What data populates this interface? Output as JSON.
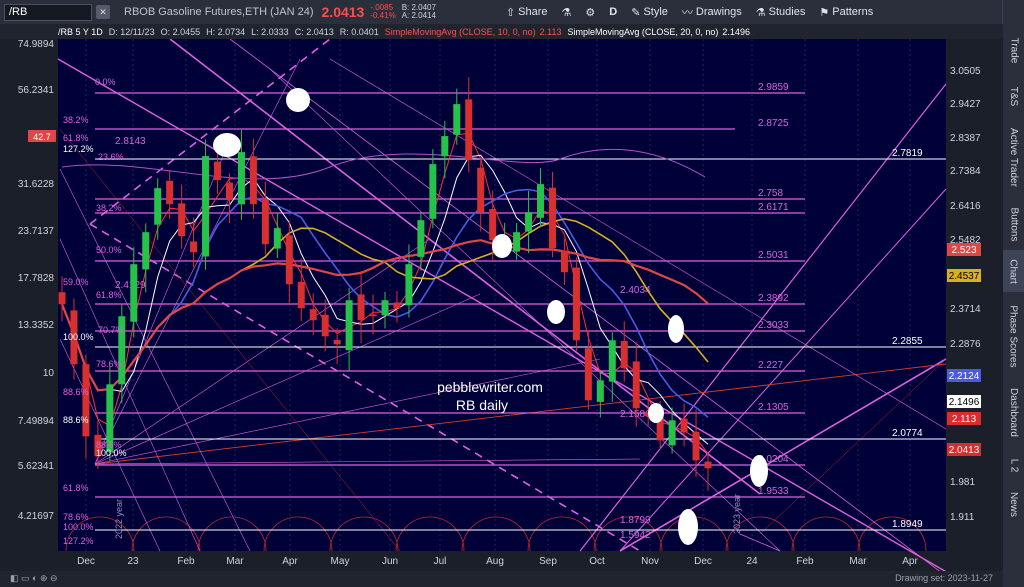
{
  "toolbar": {
    "symbol": "/RB",
    "description": "RBOB Gasoline Futures,ETH (JAN 24)",
    "last_price": "2.0413",
    "change": "-.0085",
    "change_pct": "-0.41%",
    "bid": "B: 2.0407",
    "ask": "A: 2.0414",
    "share": "Share",
    "interval": "D",
    "style": "Style",
    "drawings": "Drawings",
    "studies": "Studies",
    "patterns": "Patterns"
  },
  "sidebar": {
    "tabs": [
      "Trade",
      "T&S",
      "Active Trader",
      "Buttons",
      "Chart",
      "Phase Scores",
      "Dashboard",
      "L 2",
      "News"
    ],
    "active": "Chart"
  },
  "study_bar": {
    "label": "/RB 5 Y 1D",
    "date": "D: 12/11/23",
    "open": "O: 2.0455",
    "high": "H: 2.0734",
    "low": "L: 2.0333",
    "close": "C: 2.0413",
    "range": "R: 0.0401",
    "sma10": "SimpleMovingAvg (CLOSE, 10, 0, no)",
    "sma10_val": "2.113",
    "sma20": "SimpleMovingAvg (CLOSE, 20, 0, no)",
    "sma20_val": "2.1496"
  },
  "bottom": {
    "drawing_set": "Drawing set: 2023-11-27"
  },
  "chart_data": {
    "type": "line",
    "title": "RB daily",
    "watermark": "pebblewriter.com",
    "x_ticks": [
      "Dec",
      "23",
      "Feb",
      "Mar",
      "Apr",
      "May",
      "Jun",
      "Jul",
      "Aug",
      "Sep",
      "Oct",
      "Nov",
      "Dec",
      "24",
      "Feb",
      "Mar",
      "Apr"
    ],
    "x_tick_pos": [
      86,
      133,
      186,
      235,
      290,
      340,
      390,
      440,
      495,
      548,
      597,
      650,
      703,
      752,
      805,
      858,
      910
    ],
    "right_axis": [
      "3.0505",
      "2.9427",
      "2.8387",
      "2.7384",
      "2.6416",
      "2.5482",
      "2.4583",
      "2.3714",
      "2.2876",
      "2.2068",
      "2.1496",
      "2.113",
      "2.0413",
      "1.981",
      "1.911"
    ],
    "left_axis": [
      "74.9894",
      "56.2341",
      "42",
      "31.6228",
      "23.7137",
      "17.7828",
      "13.3352",
      "10",
      "7.49894",
      "5.62341",
      "4.21697"
    ],
    "price_tags": [
      {
        "label": "2.523",
        "color": "#e04646"
      },
      {
        "label": "2.4537",
        "color": "#d8b020"
      },
      {
        "label": "2.2124",
        "color": "#4a5be0"
      },
      {
        "label": "2.1496",
        "color": "#ffffff"
      },
      {
        "label": "2.113",
        "color": "#d92c2c"
      },
      {
        "label": "2.0413",
        "color": "#d92c2c"
      }
    ],
    "left_tag": "42.7",
    "horizontal_levels": [
      {
        "label": "2.9859",
        "color": "#e060e0"
      },
      {
        "label": "2.8725",
        "color": "#e060e0"
      },
      {
        "label": "2.8143",
        "color": "#e060e0"
      },
      {
        "label": "2.7819",
        "color": "#ffffff"
      },
      {
        "label": "2.758",
        "color": "#e060e0"
      },
      {
        "label": "2.6171",
        "color": "#e060e0"
      },
      {
        "label": "2.5031",
        "color": "#e060e0"
      },
      {
        "label": "2.4129",
        "color": "#e060e0"
      },
      {
        "label": "2.4034",
        "color": "#e060e0"
      },
      {
        "label": "2.3892",
        "color": "#e060e0"
      },
      {
        "label": "2.3033",
        "color": "#e060e0"
      },
      {
        "label": "2.2855",
        "color": "#ffffff"
      },
      {
        "label": "2.227",
        "color": "#e060e0"
      },
      {
        "label": "2.1586",
        "color": "#e060e0"
      },
      {
        "label": "2.1305",
        "color": "#e060e0"
      },
      {
        "label": "2.0774",
        "color": "#ffffff"
      },
      {
        "label": "2.0204",
        "color": "#e060e0"
      },
      {
        "label": "1.9533",
        "color": "#e060e0"
      },
      {
        "label": "1.8949",
        "color": "#ffffff"
      },
      {
        "label": "1.8799",
        "color": "#e060e0"
      },
      {
        "label": "1.5942",
        "color": "#e060e0"
      }
    ],
    "fib_labels": [
      "0.0%",
      "38.2%",
      "61.8%",
      "127.2%",
      "23.6%",
      "38.2%",
      "50.0%",
      "59.0%",
      "61.8%",
      "70.7%",
      "100.0%",
      "78.6%",
      "88.6%",
      "88.6%",
      "88.6%",
      "100.0%",
      "61.8%",
      "78.6%",
      "100.0%",
      "127.2%"
    ],
    "closes": [
      2.45,
      2.3,
      2.12,
      2.07,
      2.25,
      2.42,
      2.55,
      2.63,
      2.74,
      2.7,
      2.62,
      2.58,
      2.82,
      2.76,
      2.71,
      2.83,
      2.7,
      2.6,
      2.64,
      2.5,
      2.44,
      2.41,
      2.37,
      2.35,
      2.46,
      2.41,
      2.42,
      2.46,
      2.44,
      2.55,
      2.66,
      2.8,
      2.87,
      2.95,
      2.81,
      2.68,
      2.61,
      2.6,
      2.63,
      2.68,
      2.75,
      2.59,
      2.53,
      2.36,
      2.21,
      2.26,
      2.36,
      2.29,
      2.19,
      2.17,
      2.11,
      2.16,
      2.13,
      2.06,
      2.04
    ]
  }
}
